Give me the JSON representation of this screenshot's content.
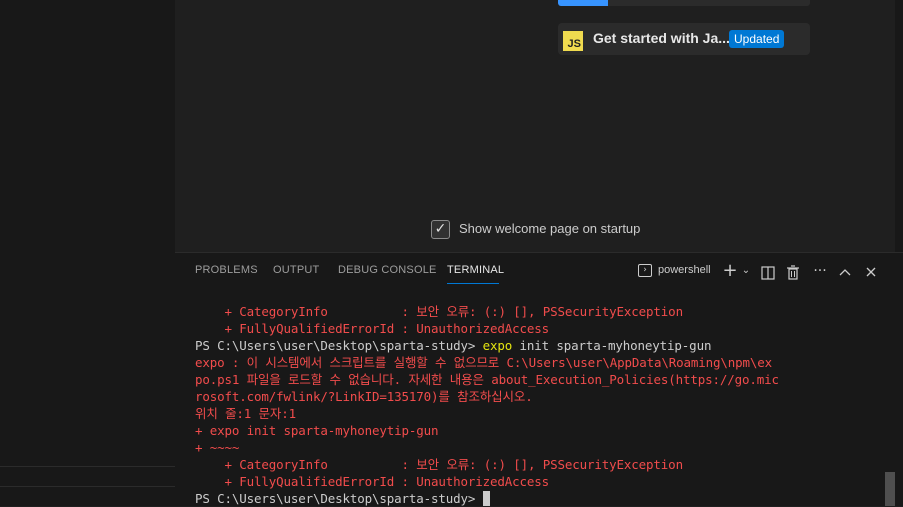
{
  "walkthrough": {
    "title": "Get started with Ja...",
    "badge": "Updated",
    "icon_text": "JS",
    "progress": 0.2
  },
  "startup": {
    "label": "Show welcome page on startup",
    "checked": true
  },
  "panel": {
    "tabs": [
      {
        "label": "PROBLEMS",
        "active": false
      },
      {
        "label": "OUTPUT",
        "active": false
      },
      {
        "label": "DEBUG CONSOLE",
        "active": false
      },
      {
        "label": "TERMINAL",
        "active": true
      }
    ],
    "shell_label": "powershell"
  },
  "terminal": {
    "line1": "    + CategoryInfo          : 보안 오류: (:) [], PSSecurityException",
    "line2": "    + FullyQualifiedErrorId : UnauthorizedAccess",
    "line3_prompt": "PS C:\\Users\\user\\Desktop\\sparta-study> ",
    "line3_cmd": "expo",
    "line3_args": " init sparta-myhoneytip-gun",
    "line4": "expo : 이 시스템에서 스크립트를 실행할 수 없으므로 C:\\Users\\user\\AppData\\Roaming\\npm\\ex",
    "line5": "po.ps1 파일을 로드할 수 없습니다. 자세한 내용은 about_Execution_Policies(https://go.mic",
    "line6": "rosoft.com/fwlink/?LinkID=135170)를 참조하십시오.",
    "line7": "위치 줄:1 문자:1",
    "line8": "+ expo init sparta-myhoneytip-gun",
    "line9": "+ ~~~~",
    "line10": "    + CategoryInfo          : 보안 오류: (:) [], PSSecurityException",
    "line11": "    + FullyQualifiedErrorId : UnauthorizedAccess",
    "line12_prompt": "PS C:\\Users\\user\\Desktop\\sparta-study> "
  },
  "colors": {
    "error": "#f14c4c",
    "command": "#e5e510",
    "accent": "#0078d4"
  }
}
